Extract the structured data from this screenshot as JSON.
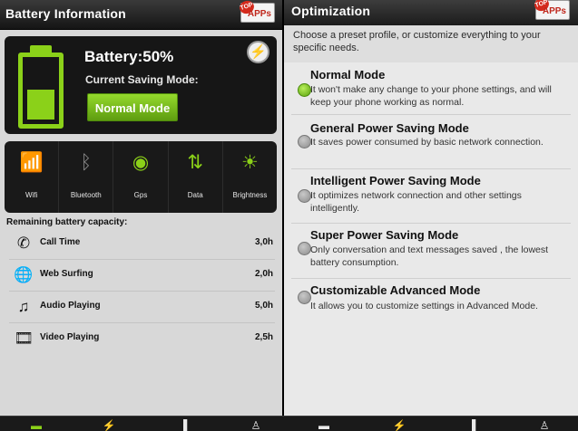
{
  "left": {
    "title": "Battery Information",
    "apps_badge": {
      "top": "TOP",
      "label": "APPs"
    },
    "battery": {
      "label": "Battery:50%",
      "level_fraction": 0.5,
      "mode_label": "Current Saving Mode:",
      "mode_button": "Normal Mode",
      "action_icon": "lightning-bolt-icon"
    },
    "toggles": [
      {
        "label": "Wifi",
        "icon": "wifi-icon",
        "glyph": "📶",
        "on": true
      },
      {
        "label": "Bluetooth",
        "icon": "bluetooth-icon",
        "glyph": "ᛒ",
        "on": false
      },
      {
        "label": "Gps",
        "icon": "gps-icon",
        "glyph": "◉",
        "on": true
      },
      {
        "label": "Data",
        "icon": "data-icon",
        "glyph": "⇅",
        "on": true
      },
      {
        "label": "Brightness",
        "icon": "brightness-icon",
        "glyph": "☀",
        "on": true
      }
    ],
    "remaining_title": "Remaining battery capacity:",
    "usage": [
      {
        "name": "Call Time",
        "value": "3,0h",
        "icon": "phone-icon",
        "glyph": "✆"
      },
      {
        "name": "Web Surfing",
        "value": "2,0h",
        "icon": "globe-icon",
        "glyph": "🌐"
      },
      {
        "name": "Audio Playing",
        "value": "5,0h",
        "icon": "music-note-icon",
        "glyph": "♫"
      },
      {
        "name": "Video Playing",
        "value": "2,5h",
        "icon": "film-reel-icon",
        "glyph": "🎞"
      }
    ]
  },
  "right": {
    "title": "Optimization",
    "apps_badge": {
      "top": "TOP",
      "label": "APPs"
    },
    "intro": "Choose a preset profile, or customize everything to your specific needs.",
    "modes": [
      {
        "name": "Normal Mode",
        "desc": "It won't make any change to your phone settings, and will keep your phone working as normal.",
        "checked": true
      },
      {
        "name": "General Power Saving Mode",
        "desc": "It saves power consumed by basic network connection.",
        "checked": false
      },
      {
        "name": "Intelligent Power Saving Mode",
        "desc": "It optimizes network connection and other settings intelligently.",
        "checked": false
      },
      {
        "name": "Super Power Saving Mode",
        "desc": "Only conversation and text messages saved , the lowest battery consumption.",
        "checked": false
      },
      {
        "name": "Customizable Advanced Mode",
        "desc": "It allows you to customize settings in Advanced Mode.",
        "checked": false
      }
    ]
  },
  "bottom_tabs": [
    {
      "icon": "battery-tab-icon",
      "glyph": "▬",
      "active": true
    },
    {
      "icon": "charge-tab-icon",
      "glyph": "⚡",
      "active": false
    },
    {
      "icon": "stats-tab-icon",
      "glyph": "▐",
      "active": false
    },
    {
      "icon": "person-tab-icon",
      "glyph": "♙",
      "active": false
    },
    {
      "icon": "battery-tab-icon-2",
      "glyph": "▬",
      "active": false
    },
    {
      "icon": "charge-tab-icon-2",
      "glyph": "⚡",
      "active": true
    },
    {
      "icon": "stats-tab-icon-2",
      "glyph": "▐",
      "active": false
    },
    {
      "icon": "person-tab-icon-2",
      "glyph": "♙",
      "active": false
    }
  ]
}
